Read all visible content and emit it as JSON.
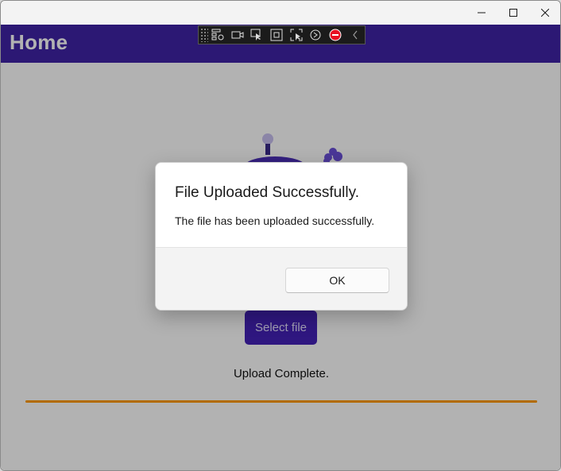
{
  "window": {
    "caption_buttons": [
      {
        "name": "minimize",
        "glyph": "—"
      },
      {
        "name": "maximize",
        "glyph": "☐"
      },
      {
        "name": "close",
        "glyph": "✕"
      }
    ]
  },
  "header": {
    "title": "Home",
    "background": "#3f23a6"
  },
  "devtools_toolbar": {
    "icons": [
      "live-visual-tree-icon",
      "video-camera-icon",
      "select-element-icon",
      "display-layout-adorners-icon",
      "track-focused-element-icon",
      "hot-reload-icon",
      "stop-icon",
      "collapse-chevron-icon"
    ]
  },
  "main": {
    "select_button_label": "Select file",
    "status_text": "Upload Complete.",
    "progress": 1.0,
    "progress_color": "#ff9a00"
  },
  "dialog": {
    "title": "File Uploaded Successfully.",
    "message": "The file has been uploaded successfully.",
    "ok_label": "OK"
  }
}
